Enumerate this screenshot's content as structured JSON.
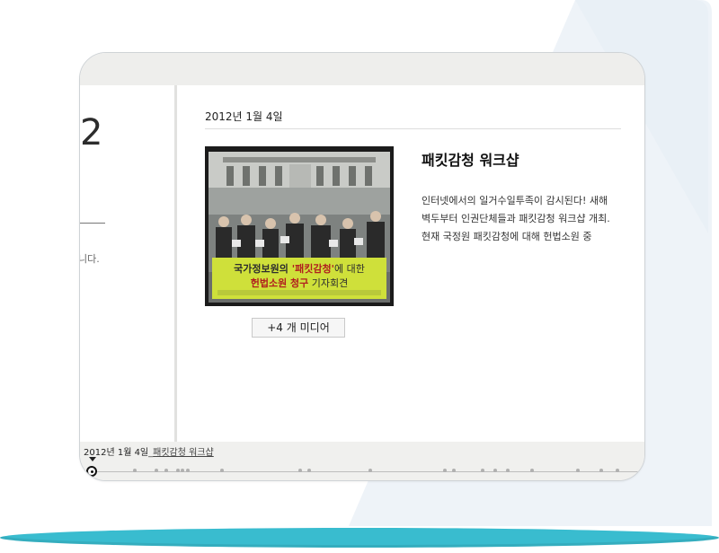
{
  "prev_slide": {
    "digit": "2",
    "text": "니다."
  },
  "slide": {
    "date": "2012년 1월 4일",
    "title": "패킷감청 워크샵",
    "description": "인터넷에서의 일거수일투족이 감시된다! 새해 벽두부터 인권단체들과 패킷감청 워크샵 개최. 현재 국정원 패킷감청에 대해 헌법소원 중",
    "media_button": "+4 개 미디어",
    "photo": {
      "banner_line1_a": "국가정보원의 ",
      "banner_line1_b": "'패킷감청'",
      "banner_line1_c": "에 대한",
      "banner_line2_a": "헌법소원 청구",
      "banner_line2_b": " 기자회견"
    }
  },
  "timeline": {
    "current_date": "2012년 1월 4일",
    "current_link": "패킷감청 워크샵"
  },
  "colors": {
    "accent_bar": "#39bccf",
    "panel_blue": "#eef3f8",
    "banner": "#cfe03a"
  }
}
